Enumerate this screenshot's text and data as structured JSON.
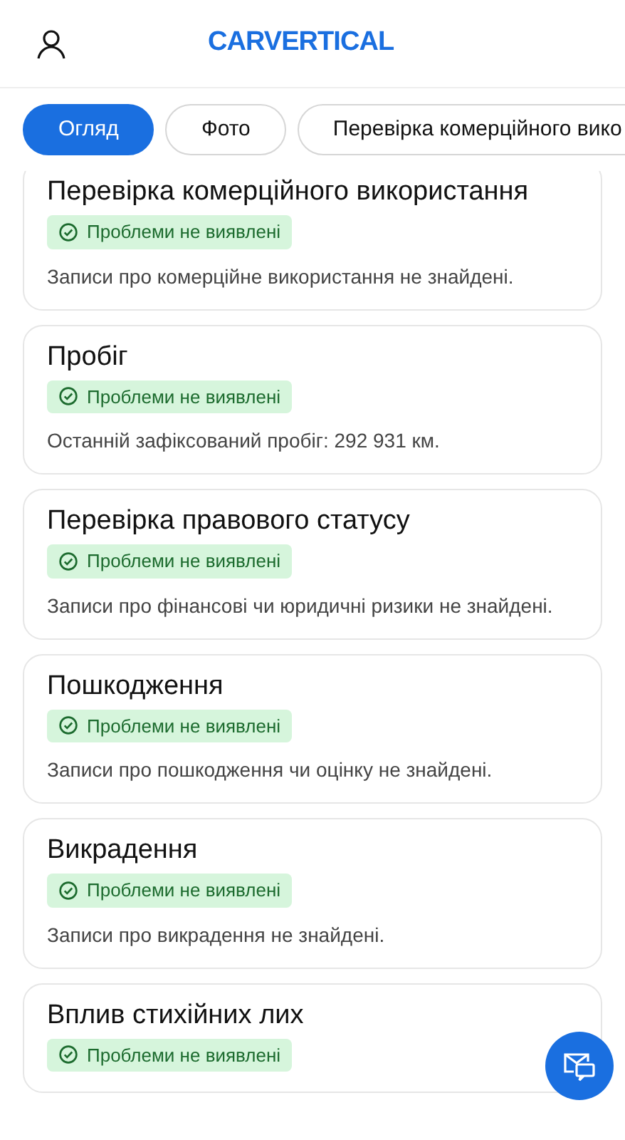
{
  "header": {
    "logo": "CARVERTICAL"
  },
  "tabs": [
    {
      "label": "Огляд",
      "selected": true
    },
    {
      "label": "Фото",
      "selected": false
    },
    {
      "label": "Перевірка комерційного вико",
      "selected": false
    }
  ],
  "cards": [
    {
      "title": "Перевірка комерційного використання",
      "status": {
        "kind": "ok",
        "label": "Проблеми не виявлені"
      },
      "text": "Записи про комерційне використання не знайдені."
    },
    {
      "title": "Пробіг",
      "status": {
        "kind": "ok",
        "label": "Проблеми не виявлені"
      },
      "text": "Останній зафіксований пробіг: 292 931 км."
    },
    {
      "title": "Перевірка правового статусу",
      "status": {
        "kind": "ok",
        "label": "Проблеми не виявлені"
      },
      "text": "Записи про фінансові чи юридичні ризики не знайдені."
    },
    {
      "title": "Пошкодження",
      "status": {
        "kind": "ok",
        "label": "Проблеми не виявлені"
      },
      "text": "Записи про пошкодження чи оцінку не знайдені."
    },
    {
      "title": "Викрадення",
      "status": {
        "kind": "ok",
        "label": "Проблеми не виявлені"
      },
      "text": "Записи про викрадення не знайдені."
    },
    {
      "title": "Вплив стихійних лих",
      "status": {
        "kind": "ok",
        "label": "Проблеми не виявлені"
      }
    }
  ]
}
